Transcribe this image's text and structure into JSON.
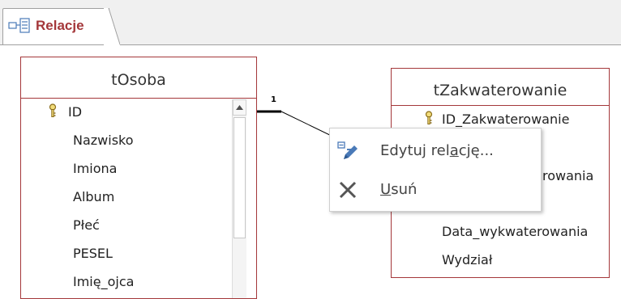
{
  "tab": {
    "label": "Relacje",
    "icon": "relationships-icon",
    "label_color": "#a4373a"
  },
  "accent_color": "#a4373a",
  "tables": {
    "osoba": {
      "title": "tOsoba",
      "fields": [
        "ID",
        "Nazwisko",
        "Imiona",
        "Album",
        "Płeć",
        "PESEL",
        "Imię_ojca"
      ],
      "primary_key": "ID"
    },
    "zakwaterowanie": {
      "title": "tZakwaterowanie",
      "fields_visible": [
        "ID_Zakwaterowanie",
        "rowania",
        "Data_wykwaterowania",
        "Wydział"
      ],
      "primary_key": "ID_Zakwaterowanie"
    }
  },
  "relationship": {
    "cardinality_one": "1"
  },
  "context_menu": {
    "edit": {
      "pre": "Edytuj rel",
      "mnemonic": "a",
      "post": "cję...",
      "icon": "edit-relationship-icon"
    },
    "delete": {
      "mnemonic": "U",
      "post": "suń",
      "icon": "delete-x-icon"
    }
  }
}
